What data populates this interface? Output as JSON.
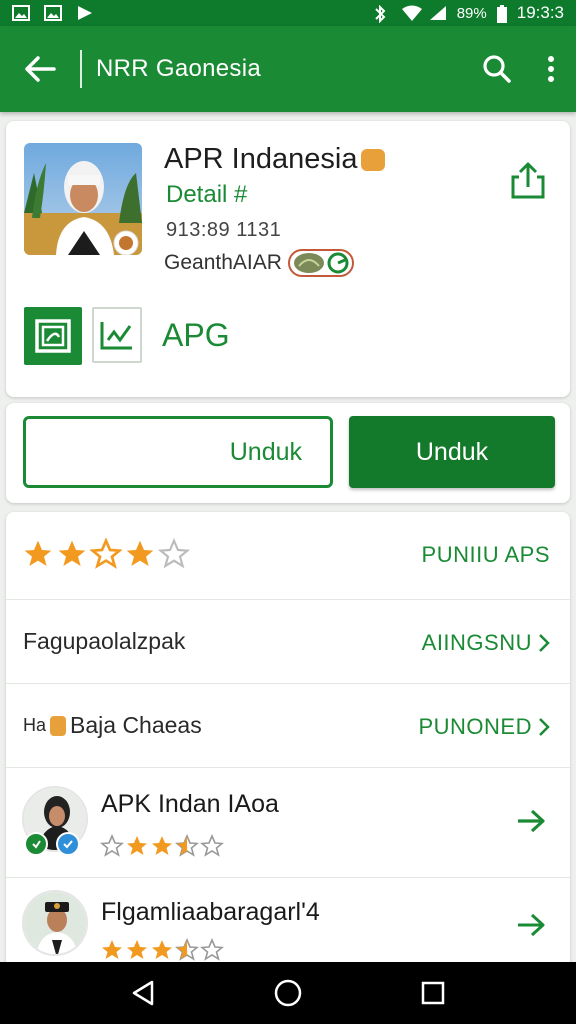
{
  "status_bar": {
    "battery": "89%",
    "time": "19:3:3",
    "icons": [
      "image-icon",
      "image-icon",
      "play-store-icon",
      "bluetooth-icon",
      "wifi-icon",
      "signal-icon",
      "battery-icon"
    ]
  },
  "app_bar": {
    "title": "NRR Gaonesia",
    "back_icon": "arrow-back-icon",
    "search_icon": "search-icon",
    "menu_icon": "more-vert-icon"
  },
  "app_header": {
    "name": "APR Indanesia",
    "link": "Detail #",
    "meta": "913:89 1131",
    "developer": "GeanthAIAR",
    "tag_label": "APG"
  },
  "actions": {
    "outline_label": "Unduk",
    "filled_label": "Unduk"
  },
  "rating_row": {
    "rating": 3.5,
    "max": 5,
    "right_label": "PUNIIU APS"
  },
  "list_rows": [
    {
      "left": "Fagupaolalzpak",
      "right": "AIINGSNU"
    },
    {
      "left": "Baja Chaeas",
      "left_prefix": "Ha",
      "right": "PUNONED"
    }
  ],
  "apps": [
    {
      "title": "APK Indan IAoa",
      "rating": 3.5
    },
    {
      "title": "Flgamliaabaragarl'4",
      "rating": 3.5
    }
  ],
  "colors": {
    "primary": "#1b8a35",
    "primary_dark": "#0d7a2c",
    "star": "#f29a1f",
    "background": "#eef0ee"
  },
  "nav": [
    "back-triangle-icon",
    "home-circle-icon",
    "recents-square-icon"
  ]
}
